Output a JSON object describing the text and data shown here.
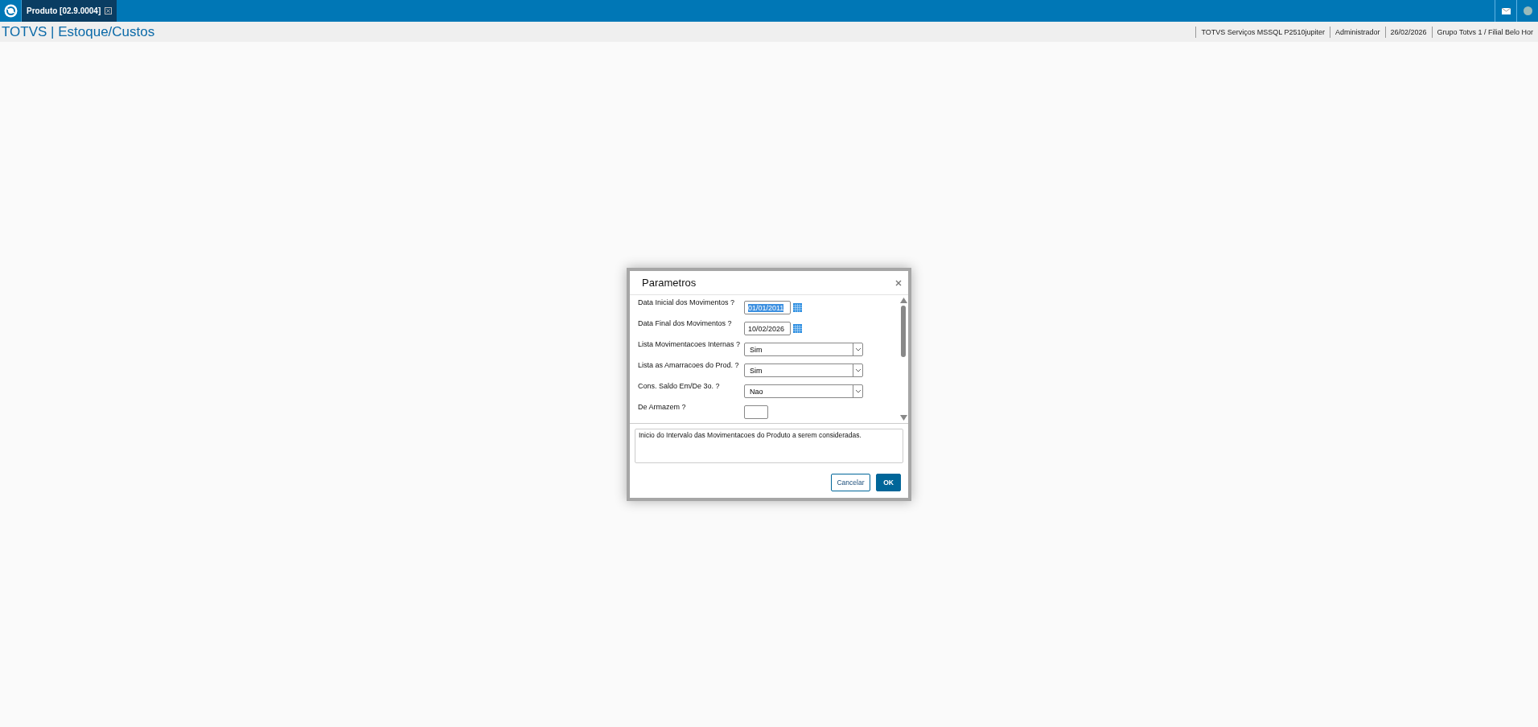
{
  "topbar": {
    "tab": {
      "label": "Produto [02.9.0004]",
      "selected": true
    }
  },
  "header": {
    "title": "TOTVS | Estoque/Custos",
    "info": [
      "TOTVS Serviços MSSQL P2510jupiter",
      "Administrador",
      "26/02/2026",
      "Grupo Totvs 1 / Filial Belo Hor"
    ]
  },
  "dialog": {
    "title": "Parametros",
    "fields": [
      {
        "kind": "date",
        "label": "Data Inicial dos Movimentos ?",
        "value": "01/01/2011",
        "selected": true
      },
      {
        "kind": "date",
        "label": "Data Final dos Movimentos ?",
        "value": "10/02/2026",
        "selected": false
      },
      {
        "kind": "select",
        "label": "Lista Movimentacoes Internas ?",
        "value": "Sim"
      },
      {
        "kind": "select",
        "label": "Lista as Amarracoes do Prod. ?",
        "value": "Sim"
      },
      {
        "kind": "select",
        "label": "Cons. Saldo Em/De 3o. ?",
        "value": "Nao"
      },
      {
        "kind": "text",
        "label": "De  Armazem ?"
      }
    ],
    "help": "Inicio do Intervalo das Movimentacoes do Produto a serem consideradas.",
    "buttons": [
      {
        "label": "Cancelar",
        "kind": "secondary"
      },
      {
        "label": "OK",
        "kind": "primary"
      }
    ]
  }
}
